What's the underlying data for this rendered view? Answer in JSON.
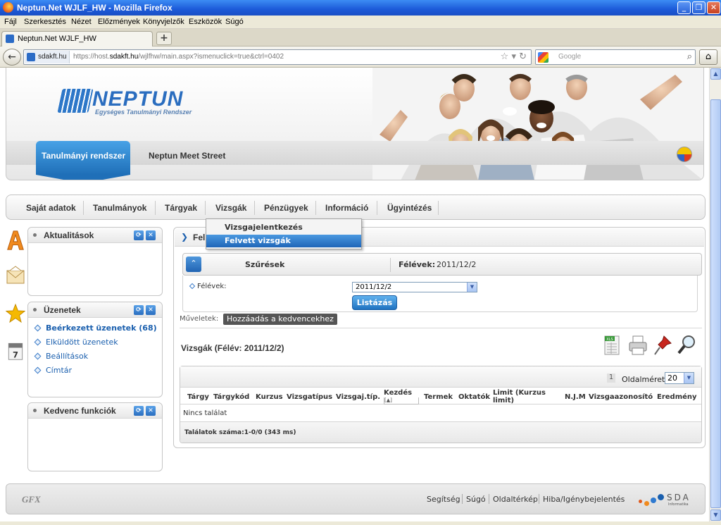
{
  "window": {
    "title": "Neptun.Net WJLF_HW - Mozilla Firefox"
  },
  "menubar": [
    "Fájl",
    "Szerkesztés",
    "Nézet",
    "Előzmények",
    "Könyvjelzők",
    "Eszközök",
    "Súgó"
  ],
  "tab": {
    "label": "Neptun.Net WJLF_HW",
    "new_tab": "+"
  },
  "navbar": {
    "site": "sdakft.hu",
    "url_prefix": "https://host.",
    "url_domain": "sdakft.hu",
    "url_path": "/wjlfhw/main.aspx?ismenuclick=true&ctrl=0402",
    "search_placeholder": "Google"
  },
  "header": {
    "logo": "NEPTUN",
    "logo_sub": "Egységes Tanulmányi Rendszer",
    "tabs": [
      "Tanulmányi rendszer",
      "Neptun Meet Street"
    ]
  },
  "mainnav": [
    "Saját adatok",
    "Tanulmányok",
    "Tárgyak",
    "Vizsgák",
    "Pénzügyek",
    "Információ",
    "Ügyintézés"
  ],
  "dropdown": [
    "Vizsgajelentkezés",
    "Felvett vizsgák"
  ],
  "panels": {
    "news": {
      "title": "Aktualitások"
    },
    "messages": {
      "title": "Üzenetek",
      "links": [
        "Beérkezett üzenetek (68)",
        "Elküldött üzenetek",
        "Beállítások",
        "Címtár"
      ]
    },
    "favorites": {
      "title": "Kedvenc funkciók"
    }
  },
  "content": {
    "title": "Fel",
    "filter": {
      "label": "Szűrések",
      "semester_label": "Félévek:",
      "semester_value": "2011/12/2",
      "field_label": "Félévek:",
      "select_value": "2011/12/2",
      "button": "Listázás"
    },
    "actions_label": "Műveletek:",
    "add_favorite": "Hozzáadás a kedvencekhez",
    "results_title": "Vizsgák (Félév: 2011/12/2)",
    "grid": {
      "page": "1",
      "page_size_label": "Oldalméret",
      "page_size": "20",
      "columns": [
        "Tárgy",
        "Tárgykód",
        "Kurzus",
        "Vizsgatípus",
        "Vizsgaj.típ.",
        "Kezdés",
        "Termek",
        "Oktatók",
        "Limit (Kurzus limit)",
        "N.J.M",
        "Vizsgaazonosító",
        "Eredmény"
      ],
      "empty": "Nincs találat",
      "footer": "Találatok száma:1-0/0 (343 ms)"
    }
  },
  "footer": {
    "gfx": "GFX",
    "links": [
      "Segítség",
      "Súgó",
      "Oldaltérkép",
      "Hiba/Igénybejelentés"
    ],
    "sda": "SDA",
    "sda_sub": "Informatika"
  }
}
